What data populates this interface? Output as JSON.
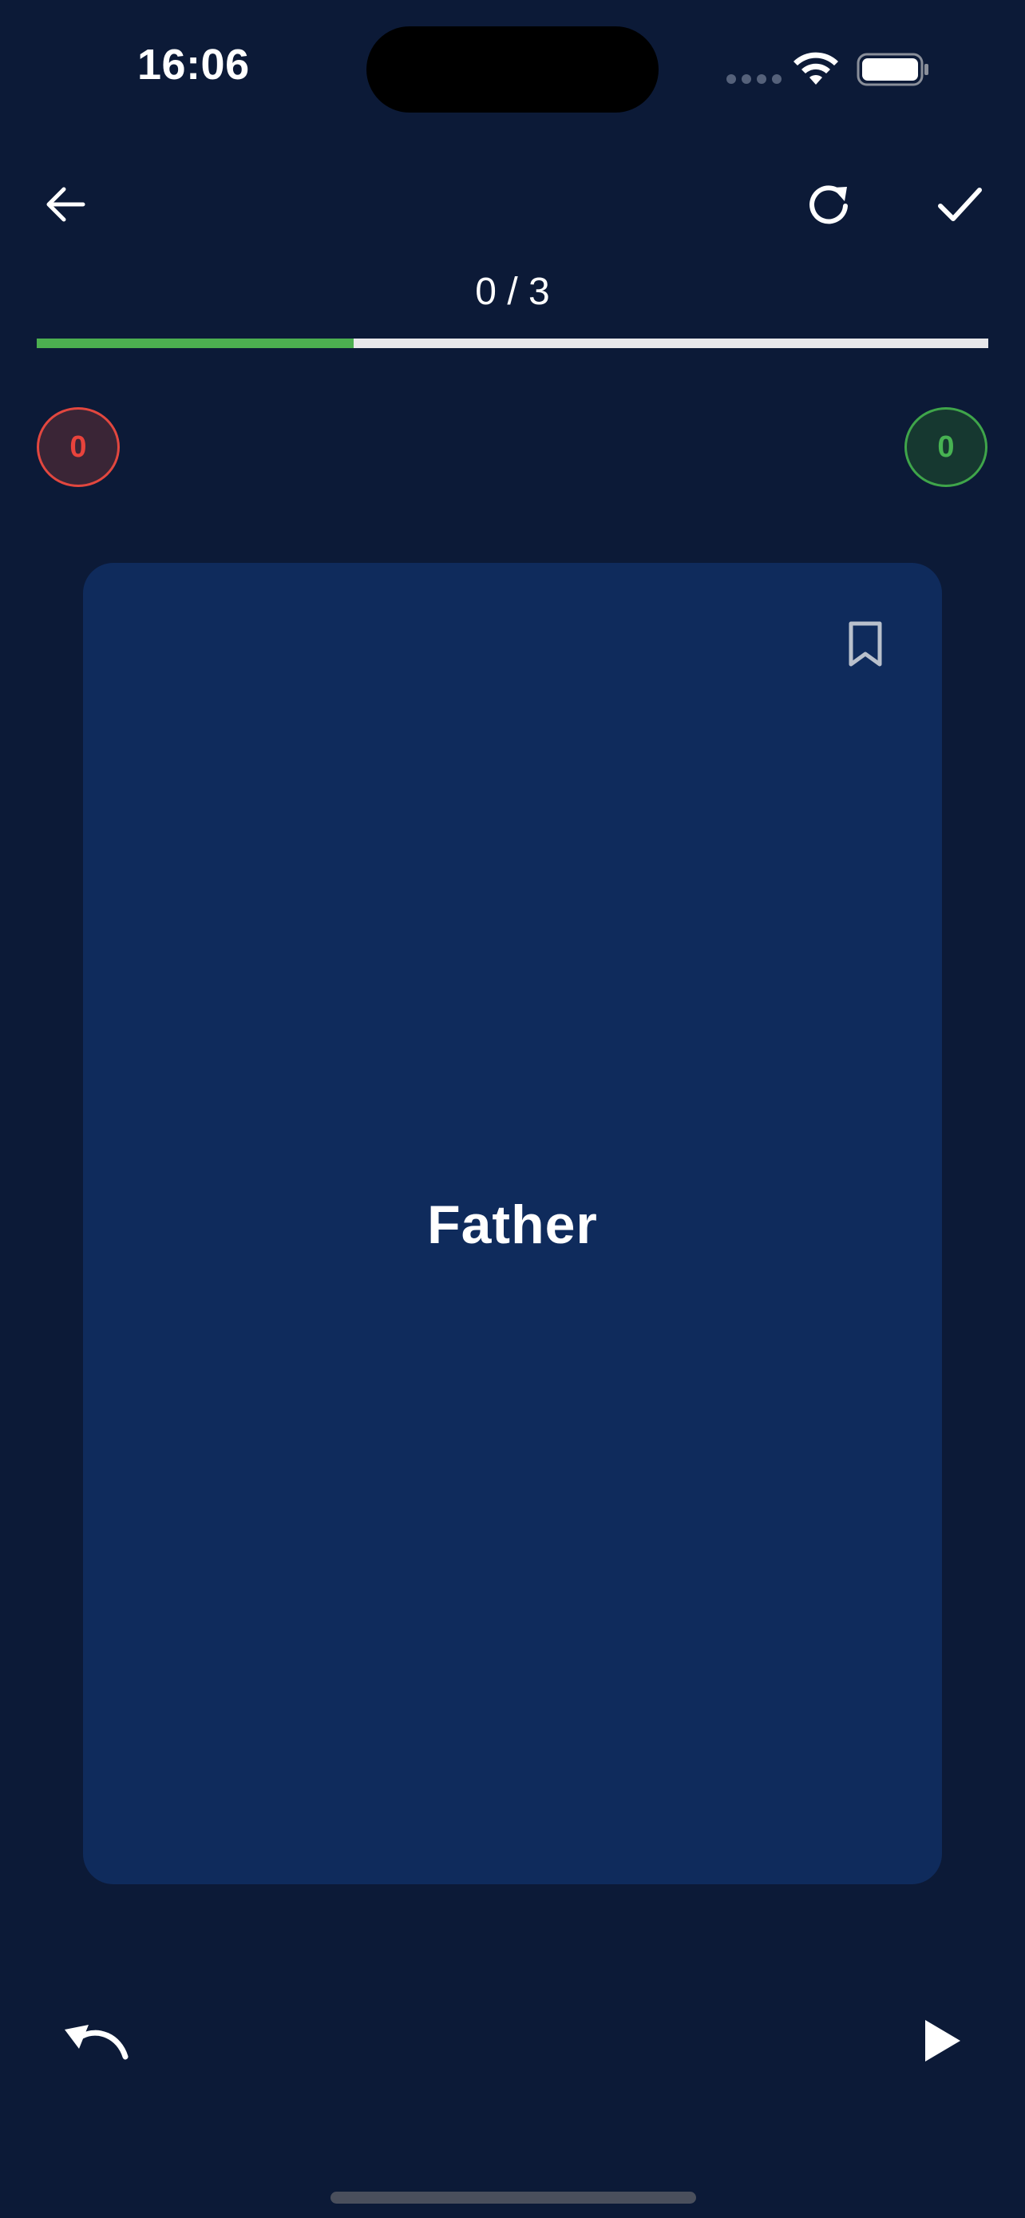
{
  "status_bar": {
    "time": "16:06"
  },
  "toolbar": {
    "back_icon": "arrow-left-icon",
    "restart_icon": "refresh-icon",
    "finish_icon": "check-icon"
  },
  "progress": {
    "label": "0 / 3",
    "fill_fraction": 0.333,
    "fill_color": "#4caf50",
    "track_color": "#e8e8ea"
  },
  "counters": {
    "wrong_count": "0",
    "wrong_color": "#e8433c",
    "right_count": "0",
    "right_color": "#47b252"
  },
  "card": {
    "term": "Father",
    "bookmark_icon": "bookmark-outline-icon",
    "background": "#0f2b5c"
  },
  "bottom_controls": {
    "undo_icon": "undo-icon",
    "play_icon": "play-icon"
  },
  "colors": {
    "background": "#0c1a37",
    "text": "#ffffff"
  }
}
